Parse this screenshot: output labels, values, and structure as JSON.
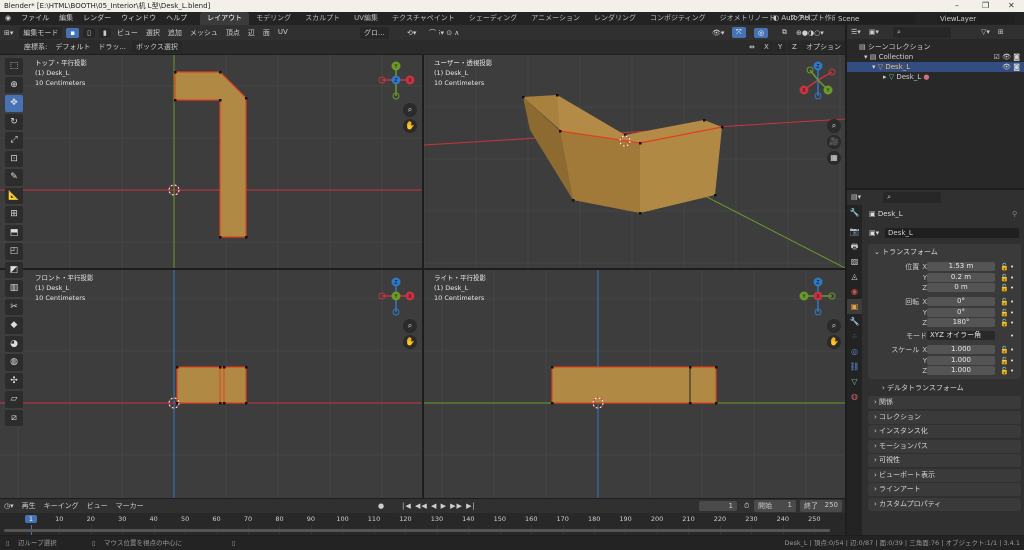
{
  "window": {
    "title": "Blender* [E:\\HTML\\BOOTH\\05_Interior\\机 L型\\Desk_L.blend]",
    "minimize": "–",
    "maximize": "❐",
    "close": "✕"
  },
  "menu": {
    "items": [
      "ファイル",
      "編集",
      "レンダー",
      "ウィンドウ",
      "ヘルプ"
    ],
    "workspaces": [
      "レイアウト",
      "モデリング",
      "スカルプト",
      "UV編集",
      "テクスチャペイント",
      "シェーディング",
      "アニメーション",
      "レンダリング",
      "コンポジティング",
      "ジオメトリノード",
      "スクリプト作成"
    ],
    "active_workspace": 0,
    "add_tab": "+",
    "auto_release": "Auto Rel...",
    "scene": "Scene",
    "view_layer": "ViewLayer"
  },
  "header": {
    "mode": "編集モード",
    "menus": [
      "ビュー",
      "選択",
      "追加",
      "メッシュ",
      "頂点",
      "辺",
      "面",
      "UV"
    ],
    "transform_orientation": "グロ...",
    "coord_label": "座標系:",
    "coord_value": "デフォルト",
    "drag_label": "ドラッ...",
    "select_mode": "ボックス選択",
    "axes": [
      "X",
      "Y",
      "Z"
    ],
    "options": "オプション"
  },
  "toolbar": {
    "tools": [
      "select-box",
      "cursor",
      "move",
      "rotate",
      "scale",
      "transform",
      "annotate",
      "measure",
      "add-cube",
      "extrude",
      "inset",
      "bevel",
      "loop-cut",
      "knife",
      "poly-build",
      "spin",
      "smooth",
      "shrink-fatten",
      "shear",
      "rip"
    ],
    "active": 2
  },
  "viewports": [
    {
      "name": "トップ・平行投影",
      "object": "(1) Desk_L",
      "scale": "10 Centimeters"
    },
    {
      "name": "ユーザー・透視投影",
      "object": "(1) Desk_L",
      "scale": "10 Centimeters"
    },
    {
      "name": "フロント・平行投影",
      "object": "(1) Desk_L",
      "scale": "10 Centimeters"
    },
    {
      "name": "ライト・平行投影",
      "object": "(1) Desk_L",
      "scale": "10 Centimeters"
    }
  ],
  "gizmo": {
    "x": "X",
    "y": "Y",
    "z": "Z"
  },
  "colors": {
    "accent": "#4772b3",
    "mesh": "#b08a44",
    "edge_selected": "#e0401c",
    "axis_x": "#c8343f",
    "axis_y": "#6b9a2a",
    "axis_z": "#2f78c8"
  },
  "outliner": {
    "root": "シーンコレクション",
    "collection": "Collection",
    "object": "Desk_L",
    "mesh": "Desk_L"
  },
  "properties": {
    "object_name": "Desk_L",
    "data_name": "Desk_L",
    "transform_title": "トランスフォーム",
    "location": {
      "label": "位置",
      "x": "1.53 m",
      "y": "0.2 m",
      "z": "0 m"
    },
    "rotation": {
      "label": "回転",
      "x": "0°",
      "y": "0°",
      "z": "180°"
    },
    "mode_label": "モード",
    "mode": "XYZ オイラー角",
    "scale": {
      "label": "スケール",
      "x": "1.000",
      "y": "1.000",
      "z": "1.000"
    },
    "axis_x": "X",
    "axis_y": "Y",
    "axis_z": "Z",
    "delta": "デルタトランスフォーム",
    "panels": [
      "関係",
      "コレクション",
      "インスタンス化",
      "モーションパス",
      "可視性",
      "ビューポート表示",
      "ラインアート",
      "カスタムプロパティ"
    ]
  },
  "timeline": {
    "menus": [
      "再生",
      "キーイング",
      "ビュー",
      "マーカー"
    ],
    "current_frame": "1",
    "start_label": "開始",
    "start": "1",
    "end_label": "終了",
    "end": "250",
    "ticks": [
      "1",
      "10",
      "20",
      "30",
      "40",
      "50",
      "60",
      "70",
      "80",
      "90",
      "100",
      "110",
      "120",
      "130",
      "140",
      "150",
      "160",
      "170",
      "180",
      "190",
      "200",
      "210",
      "220",
      "230",
      "240",
      "250"
    ]
  },
  "status": {
    "left": "辺ループ選択",
    "middle": "マウス位置を視点の中心に",
    "right": "Desk_L | 頂点:0/54 | 辺:0/87 | 面:0/39 | 三角面:76 | オブジェクト:1/1 | 3.4.1"
  }
}
